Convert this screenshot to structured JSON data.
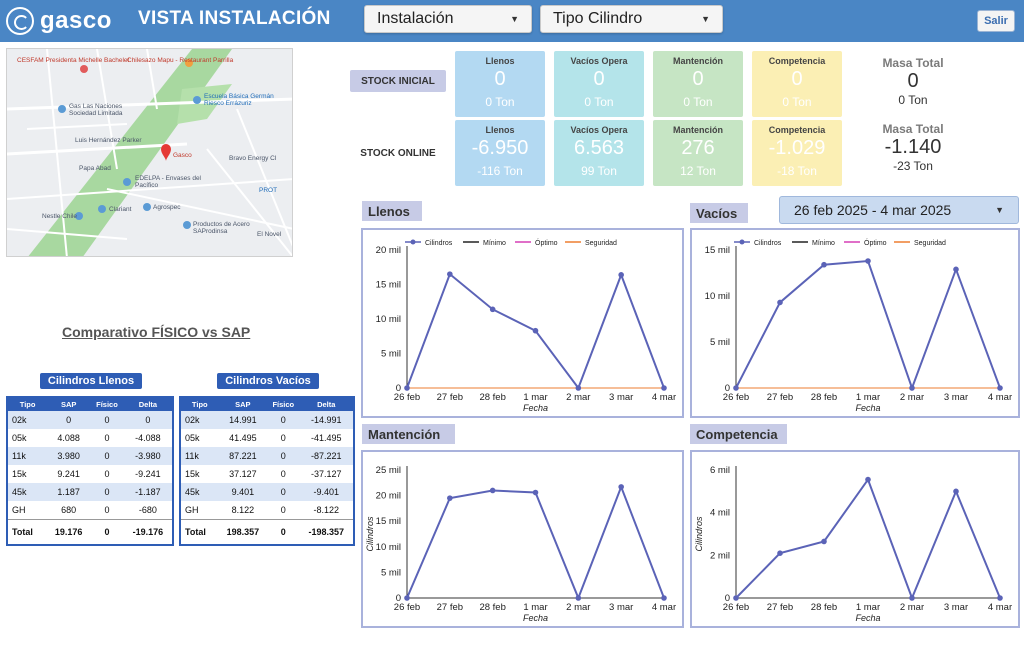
{
  "header": {
    "logo_text": "gasco",
    "title": "VISTA INSTALACIÓN",
    "dropdown_instalacion": "Instalación",
    "dropdown_cilindro": "Tipo Cilindro",
    "exit_label": "Salir"
  },
  "map": {
    "labels": [
      "CESFAM Presidenta Michelle Bachelet",
      "Chilesazo Mapu - Restaurant Parrilla",
      "Escuela Básica Germán Riesco Errázuriz",
      "Gas Las Naciones Sociedad Limitada",
      "Luis Hernández Parker",
      "Gasco",
      "Bravo Energy Cl",
      "Papa Abad",
      "EDELPA - Envases del Pacífico",
      "Clariant",
      "Agrospec",
      "PROT",
      "Nestle Chile",
      "Productos de Acero SAProdinsa",
      "El Novel"
    ]
  },
  "stock": {
    "initial_label": "STOCK INICIAL",
    "online_label": "STOCK ONLINE",
    "colors": {
      "llenos": "#b3d9f2",
      "vacios": "#b4e4ea",
      "mantencion": "#c6e5c4",
      "competencia": "#fbefb4"
    },
    "initial": [
      {
        "title": "Llenos",
        "value": "0",
        "tons": "0 Ton"
      },
      {
        "title": "Vacíos Opera",
        "value": "0",
        "tons": "0 Ton"
      },
      {
        "title": "Mantención",
        "value": "0",
        "tons": "0 Ton"
      },
      {
        "title": "Competencia",
        "value": "0",
        "tons": "0 Ton"
      }
    ],
    "online": [
      {
        "title": "Llenos",
        "value": "-6.950",
        "tons": "-116 Ton"
      },
      {
        "title": "Vacíos Opera",
        "value": "6.563",
        "tons": "99 Ton"
      },
      {
        "title": "Mantención",
        "value": "276",
        "tons": "12 Ton"
      },
      {
        "title": "Competencia",
        "value": "-1.029",
        "tons": "-18 Ton"
      }
    ],
    "masa_initial": {
      "title": "Masa Total",
      "value": "0",
      "tons": "0 Ton"
    },
    "masa_online": {
      "title": "Masa Total",
      "value": "-1.140",
      "tons": "-23 Ton"
    }
  },
  "date_range": "26 feb 2025 - 4 mar 2025",
  "comparison": {
    "title": "Comparativo FÍSICO vs SAP",
    "llenos": {
      "title": "Cilindros Llenos",
      "columns": [
        "Tipo",
        "SAP",
        "Físico",
        "Delta"
      ],
      "rows": [
        [
          "02k",
          "0",
          "0",
          "0"
        ],
        [
          "05k",
          "4.088",
          "0",
          "-4.088"
        ],
        [
          "11k",
          "3.980",
          "0",
          "-3.980"
        ],
        [
          "15k",
          "9.241",
          "0",
          "-9.241"
        ],
        [
          "45k",
          "1.187",
          "0",
          "-1.187"
        ],
        [
          "GH",
          "680",
          "0",
          "-680"
        ]
      ],
      "total": [
        "Total",
        "19.176",
        "0",
        "-19.176"
      ]
    },
    "vacios": {
      "title": "Cilindros Vacíos",
      "columns": [
        "Tipo",
        "SAP",
        "Físico",
        "Delta"
      ],
      "rows": [
        [
          "02k",
          "14.991",
          "0",
          "-14.991"
        ],
        [
          "05k",
          "41.495",
          "0",
          "-41.495"
        ],
        [
          "11k",
          "87.221",
          "0",
          "-87.221"
        ],
        [
          "15k",
          "37.127",
          "0",
          "-37.127"
        ],
        [
          "45k",
          "9.401",
          "0",
          "-9.401"
        ],
        [
          "GH",
          "8.122",
          "0",
          "-8.122"
        ]
      ],
      "total": [
        "Total",
        "198.357",
        "0",
        "-198.357"
      ]
    }
  },
  "chart_data": [
    {
      "type": "line",
      "title": "Llenos",
      "xlabel": "Fecha",
      "ylabel": "",
      "categories": [
        "26 feb",
        "27 feb",
        "28 feb",
        "1 mar",
        "2 mar",
        "3 mar",
        "4 mar"
      ],
      "ylim": [
        0,
        20000
      ],
      "yticks": [
        0,
        5000,
        10000,
        15000,
        20000
      ],
      "ytick_labels": [
        "0",
        "5 mil",
        "10 mil",
        "15 mil",
        "20 mil"
      ],
      "legend": [
        "Cilindros",
        "Mínimo",
        "Óptimo",
        "Seguridad"
      ],
      "legend_position": "top-left",
      "series": [
        {
          "name": "Cilindros",
          "values": [
            0,
            16500,
            11400,
            8300,
            0,
            16400,
            0
          ]
        },
        {
          "name": "Mínimo",
          "values": [
            0,
            0,
            0,
            0,
            0,
            0,
            0
          ]
        },
        {
          "name": "Óptimo",
          "values": [
            0,
            0,
            0,
            0,
            0,
            0,
            0
          ]
        },
        {
          "name": "Seguridad",
          "values": [
            0,
            0,
            0,
            0,
            0,
            0,
            0
          ]
        }
      ]
    },
    {
      "type": "line",
      "title": "Vacíos",
      "xlabel": "Fecha",
      "ylabel": "",
      "categories": [
        "26 feb",
        "27 feb",
        "28 feb",
        "1 mar",
        "2 mar",
        "3 mar",
        "4 mar"
      ],
      "ylim": [
        0,
        15000
      ],
      "yticks": [
        0,
        5000,
        10000,
        15000
      ],
      "ytick_labels": [
        "0",
        "5 mil",
        "10 mil",
        "15 mil"
      ],
      "legend": [
        "Cilindros",
        "Mínimo",
        "Óptimo",
        "Seguridad"
      ],
      "legend_position": "top-left",
      "series": [
        {
          "name": "Cilindros",
          "values": [
            0,
            9300,
            13400,
            13800,
            0,
            12900,
            0
          ]
        },
        {
          "name": "Mínimo",
          "values": [
            0,
            0,
            0,
            0,
            0,
            0,
            0
          ]
        },
        {
          "name": "Óptimo",
          "values": [
            0,
            0,
            0,
            0,
            0,
            0,
            0
          ]
        },
        {
          "name": "Seguridad",
          "values": [
            0,
            0,
            0,
            0,
            0,
            0,
            0
          ]
        }
      ]
    },
    {
      "type": "line",
      "title": "Mantención",
      "xlabel": "Fecha",
      "ylabel": "Cilindros",
      "categories": [
        "26 feb",
        "27 feb",
        "28 feb",
        "1 mar",
        "2 mar",
        "3 mar",
        "4 mar"
      ],
      "ylim": [
        0,
        25000
      ],
      "yticks": [
        0,
        5000,
        10000,
        15000,
        20000,
        25000
      ],
      "ytick_labels": [
        "0",
        "5 mil",
        "10 mil",
        "15 mil",
        "20 mil",
        "25 mil"
      ],
      "series": [
        {
          "name": "Cilindros",
          "values": [
            0,
            19500,
            21000,
            20600,
            0,
            21700,
            0
          ]
        }
      ]
    },
    {
      "type": "line",
      "title": "Competencia",
      "xlabel": "Fecha",
      "ylabel": "Cilindros",
      "categories": [
        "26 feb",
        "27 feb",
        "28 feb",
        "1 mar",
        "2 mar",
        "3 mar",
        "4 mar"
      ],
      "ylim": [
        0,
        6000
      ],
      "yticks": [
        0,
        2000,
        4000,
        6000
      ],
      "ytick_labels": [
        "0",
        "2 mil",
        "4 mil",
        "6 mil"
      ],
      "series": [
        {
          "name": "Cilindros",
          "values": [
            0,
            2100,
            2650,
            5550,
            0,
            5000,
            0
          ]
        }
      ]
    }
  ]
}
